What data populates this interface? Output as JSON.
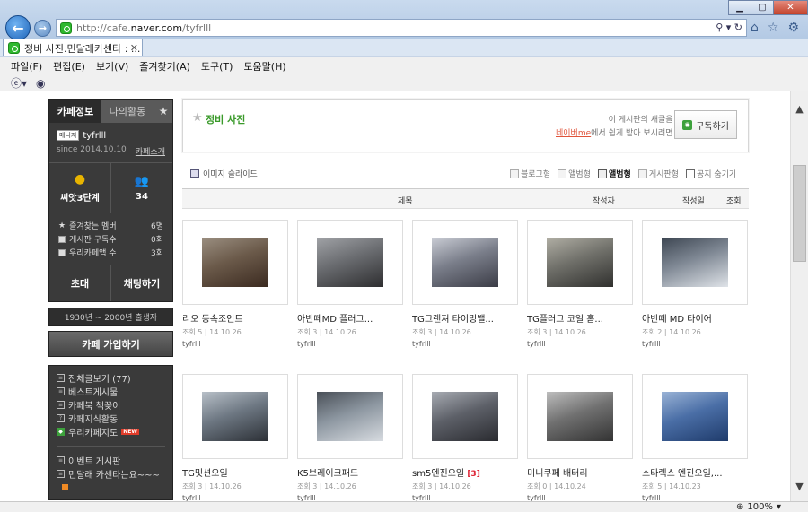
{
  "browser": {
    "url_prefix": "http://cafe.",
    "url_host": "naver.com",
    "url_path": "/tyfrlll",
    "tab_title": "정비 사진.민달래카센타 : ...",
    "menu": [
      "파일(F)",
      "편집(E)",
      "보기(V)",
      "즐겨찾기(A)",
      "도구(T)",
      "도움말(H)"
    ],
    "zoom": "100%"
  },
  "sidebar": {
    "tab_info": "카페정보",
    "tab_activity": "나의활동",
    "manager_badge": "매니저",
    "cafe_id": "tyfrlll",
    "since": "since 2014.10.10",
    "cafe_intro": "카페소개",
    "level": "씨앗3단계",
    "members": "34",
    "stats": [
      {
        "label": "즐겨찾는 멤버",
        "value": "6명"
      },
      {
        "label": "게시판 구독수",
        "value": "0회"
      },
      {
        "label": "우리카페앱 수",
        "value": "3회"
      }
    ],
    "invite": "초대",
    "chat": "채팅하기",
    "birth": "1930년 ~ 2000년 출생자",
    "join": "카페 가입하기",
    "menu1": [
      "전체글보기 (77)",
      "베스트게시물",
      "카페북 책꽂이",
      "카페지식활동",
      "우리카페지도"
    ],
    "new_badge": "NEW",
    "menu2": [
      "이벤트 게시판",
      "민달래 카센타는요~~~"
    ]
  },
  "board": {
    "title": "정비 사진",
    "sub_line1": "이 게시판의 새글을",
    "sub_link": "네이버me",
    "sub_line2": "에서 쉽게 받아 보시려면",
    "subscribe": "구독하기",
    "slideshow": "이미지 슬라이드",
    "views": [
      "블로그형",
      "앨범형",
      "앨범형",
      "게시판형"
    ],
    "notice_hide": "공지 숨기기",
    "headers": {
      "title": "제목",
      "author": "작성자",
      "date": "작성일",
      "views": "조회"
    }
  },
  "posts": [
    {
      "title": "리오 등속조인트",
      "meta": "조회 5 | 14.10.26",
      "author": "tyfrlll",
      "count": ""
    },
    {
      "title": "아반떼MD 플러그...",
      "meta": "조회 3 | 14.10.26",
      "author": "tyfrlll",
      "count": ""
    },
    {
      "title": "TG그랜져 타이밍밸...",
      "meta": "조회 3 | 14.10.26",
      "author": "tyfrlll",
      "count": ""
    },
    {
      "title": "TG플러그 코일 홈...",
      "meta": "조회 3 | 14.10.26",
      "author": "tyfrlll",
      "count": ""
    },
    {
      "title": "아반떼 MD 타이어",
      "meta": "조회 2 | 14.10.26",
      "author": "tyfrlll",
      "count": ""
    },
    {
      "title": "TG밋션오일",
      "meta": "조회 3 | 14.10.26",
      "author": "tyfrlll",
      "count": ""
    },
    {
      "title": "K5브레이크패드",
      "meta": "조회 3 | 14.10.26",
      "author": "tyfrlll",
      "count": ""
    },
    {
      "title": "sm5엔진오일",
      "meta": "조회 3 | 14.10.26",
      "author": "tyfrlll",
      "count": "[3]"
    },
    {
      "title": "미니쿠페 배터리",
      "meta": "조회 0 | 14.10.24",
      "author": "tyfrlll",
      "count": ""
    },
    {
      "title": "스타렉스 엔진오일,...",
      "meta": "조회 5 | 14.10.23",
      "author": "tyfrlll",
      "count": ""
    }
  ]
}
